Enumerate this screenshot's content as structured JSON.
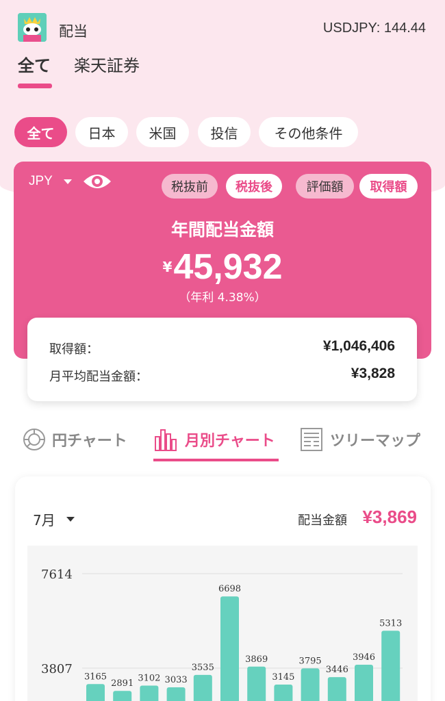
{
  "header": {
    "title": "配当",
    "rate": "USDJPY: 144.44",
    "tabs": [
      "全て",
      "楽天証券"
    ]
  },
  "filters": [
    "全て",
    "日本",
    "米国",
    "投信",
    "その他条件"
  ],
  "summary": {
    "currency": "JPY",
    "toggles": [
      "税抜前",
      "税抜後",
      "評価額",
      "取得額"
    ],
    "label": "年間配当金額",
    "yen": "¥",
    "amount": "45,932",
    "rate": "（年利 4.38%）",
    "details": [
      {
        "label": "取得額：",
        "value": "¥1,046,406"
      },
      {
        "label": "月平均配当金額：",
        "value": "¥3,828"
      }
    ]
  },
  "chart_tabs": [
    "円チャート",
    "月別チャート",
    "ツリーマップ"
  ],
  "chart_panel": {
    "month": "7月",
    "amount_label": "配当金額",
    "amount_value": "¥3,869"
  },
  "chart_data": {
    "type": "bar",
    "y_ticks": [
      3807,
      7614
    ],
    "ylim": [
      0,
      7614
    ],
    "values": [
      3165,
      2891,
      3102,
      3033,
      3535,
      6698,
      3869,
      3145,
      3795,
      3446,
      3946,
      5313
    ],
    "bar_color": "#66d1be"
  },
  "colors": {
    "accent": "#ea4c89",
    "bar": "#66d1be",
    "header_bg": "#fce7ee"
  }
}
